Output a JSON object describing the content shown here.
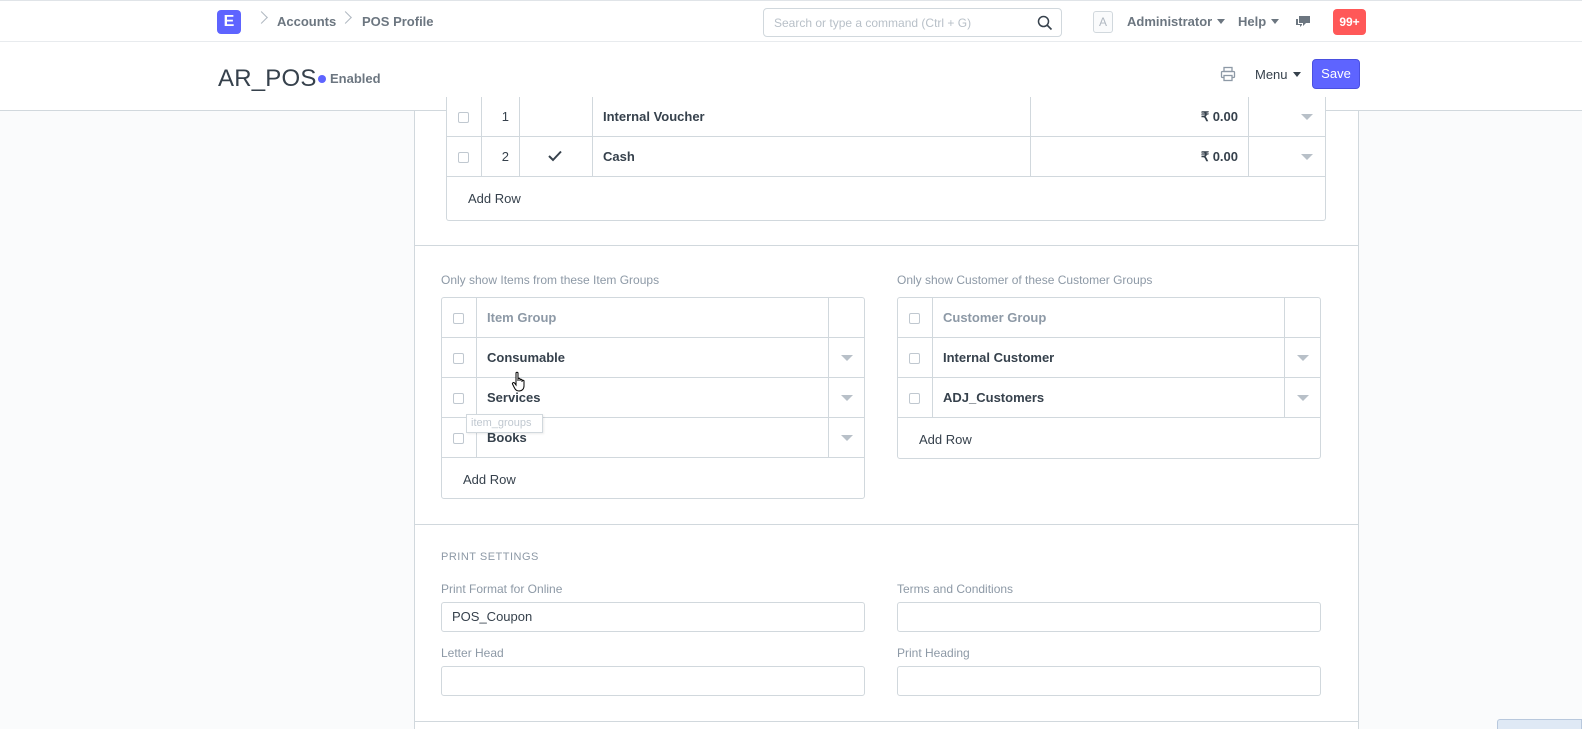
{
  "navbar": {
    "logo_letter": "E",
    "breadcrumbs": [
      "Accounts",
      "POS Profile"
    ],
    "search_placeholder": "Search or type a command (Ctrl + G)",
    "avatar_letter": "A",
    "user": "Administrator",
    "help": "Help",
    "notifications": "99+"
  },
  "header": {
    "title": "AR_POS",
    "status": "Enabled",
    "menu": "Menu",
    "save": "Save"
  },
  "payments": {
    "rows": [
      {
        "idx": "1",
        "default": false,
        "mode": "Internal Voucher",
        "amount": "₹ 0.00"
      },
      {
        "idx": "2",
        "default": true,
        "mode": "Cash",
        "amount": "₹ 0.00"
      }
    ],
    "add_row": "Add Row"
  },
  "item_groups": {
    "label": "Only show Items from these Item Groups",
    "column": "Item Group",
    "rows": [
      "Consumable",
      "Services",
      "Books"
    ],
    "add_row": "Add Row",
    "tooltip": "item_groups"
  },
  "customer_groups": {
    "label": "Only show Customer of these Customer Groups",
    "column": "Customer Group",
    "rows": [
      "Internal Customer",
      "ADJ_Customers"
    ],
    "add_row": "Add Row"
  },
  "print_settings": {
    "heading": "PRINT SETTINGS",
    "print_format_label": "Print Format for Online",
    "print_format_value": "POS_Coupon",
    "terms_label": "Terms and Conditions",
    "terms_value": "",
    "letter_head_label": "Letter Head",
    "letter_head_value": "",
    "print_heading_label": "Print Heading",
    "print_heading_value": ""
  },
  "colors": {
    "primary": "#5e64ff",
    "notification": "#ff5858"
  }
}
